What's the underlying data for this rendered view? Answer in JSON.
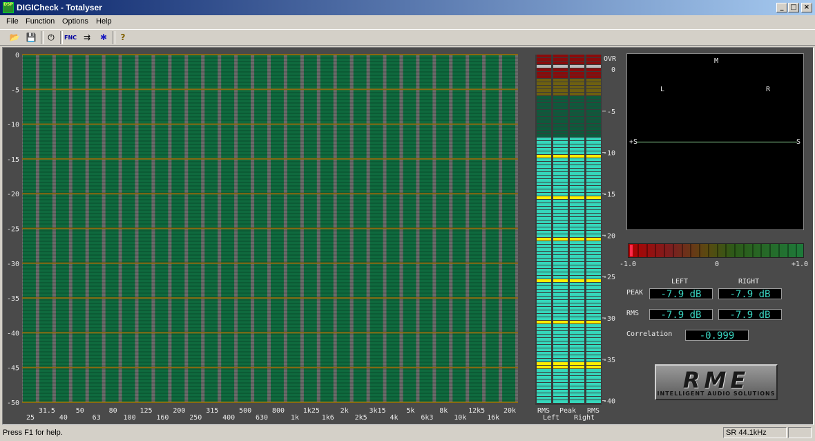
{
  "window": {
    "title": "DIGICheck - Totalyser",
    "icon_text": "DSP",
    "controls": [
      "_",
      "□",
      "×"
    ]
  },
  "menu": [
    "File",
    "Function",
    "Options",
    "Help"
  ],
  "toolbar": {
    "buttons": [
      {
        "name": "open-icon",
        "glyph": "📂"
      },
      {
        "name": "save-icon",
        "glyph": "💾"
      },
      {
        "name": "power-icon",
        "glyph": "⏻"
      },
      {
        "name": "fnc-icon",
        "glyph": "FNC"
      },
      {
        "name": "settings-icon",
        "glyph": "⇉"
      },
      {
        "name": "bug-icon",
        "glyph": "✱"
      },
      {
        "name": "help-icon",
        "glyph": "?"
      }
    ]
  },
  "analyzer": {
    "db_ticks": [
      "0",
      "-5",
      "-10",
      "-15",
      "-20",
      "-25",
      "-30",
      "-35",
      "-40",
      "-45",
      "-50"
    ],
    "freq_top": [
      "31.5",
      "50",
      "80",
      "125",
      "200",
      "315",
      "500",
      "800",
      "1k25",
      "2k",
      "3k15",
      "5k",
      "8k",
      "12k5",
      "20k"
    ],
    "freq_bottom": [
      "25",
      "40",
      "63",
      "100",
      "160",
      "250",
      "400",
      "630",
      "1k",
      "1k6",
      "2k5",
      "4k",
      "6k3",
      "10k",
      "16k"
    ],
    "bands": 30,
    "colors": {
      "bar": "#0f6a3e",
      "gap": "#6a6a6a",
      "ref_line": "#8a6a10"
    }
  },
  "level_meter": {
    "scale": [
      "OVR",
      "0",
      "-5",
      "-10",
      "-15",
      "-20",
      "-25",
      "-30",
      "-35",
      "-40"
    ],
    "labels_top": [
      "RMS",
      "Peak",
      "RMS"
    ],
    "labels_bottom": [
      "Left",
      "Right"
    ],
    "level_db": -7.9,
    "colors": {
      "over": "#8a0b0b",
      "warn": "#6e6010",
      "hi": "#0e5a3c",
      "lit": "#35d7bb",
      "yellow": "#ffee00"
    }
  },
  "goniometer": {
    "labels": {
      "m": "M",
      "l": "L",
      "r": "R",
      "s_left": "+S",
      "s_right": "S"
    },
    "line_color": "#9ae6a0"
  },
  "correlation_meter": {
    "scale": [
      "-1.0",
      "0",
      "+1.0"
    ],
    "value": -0.999
  },
  "readouts": {
    "left_header": "LEFT",
    "right_header": "RIGHT",
    "peak_label": "PEAK",
    "rms_label": "RMS",
    "corr_label": "Correlation",
    "peak_left": "-7.9 dB",
    "peak_right": "-7.9 dB",
    "rms_left": "-7.9 dB",
    "rms_right": "-7.9 dB",
    "correlation": "-0.999"
  },
  "logo": {
    "text": "RME",
    "subtitle": "INTELLIGENT AUDIO SOLUTIONS"
  },
  "status": {
    "left": "Press F1 for help.",
    "right": "SR 44.1kHz"
  }
}
